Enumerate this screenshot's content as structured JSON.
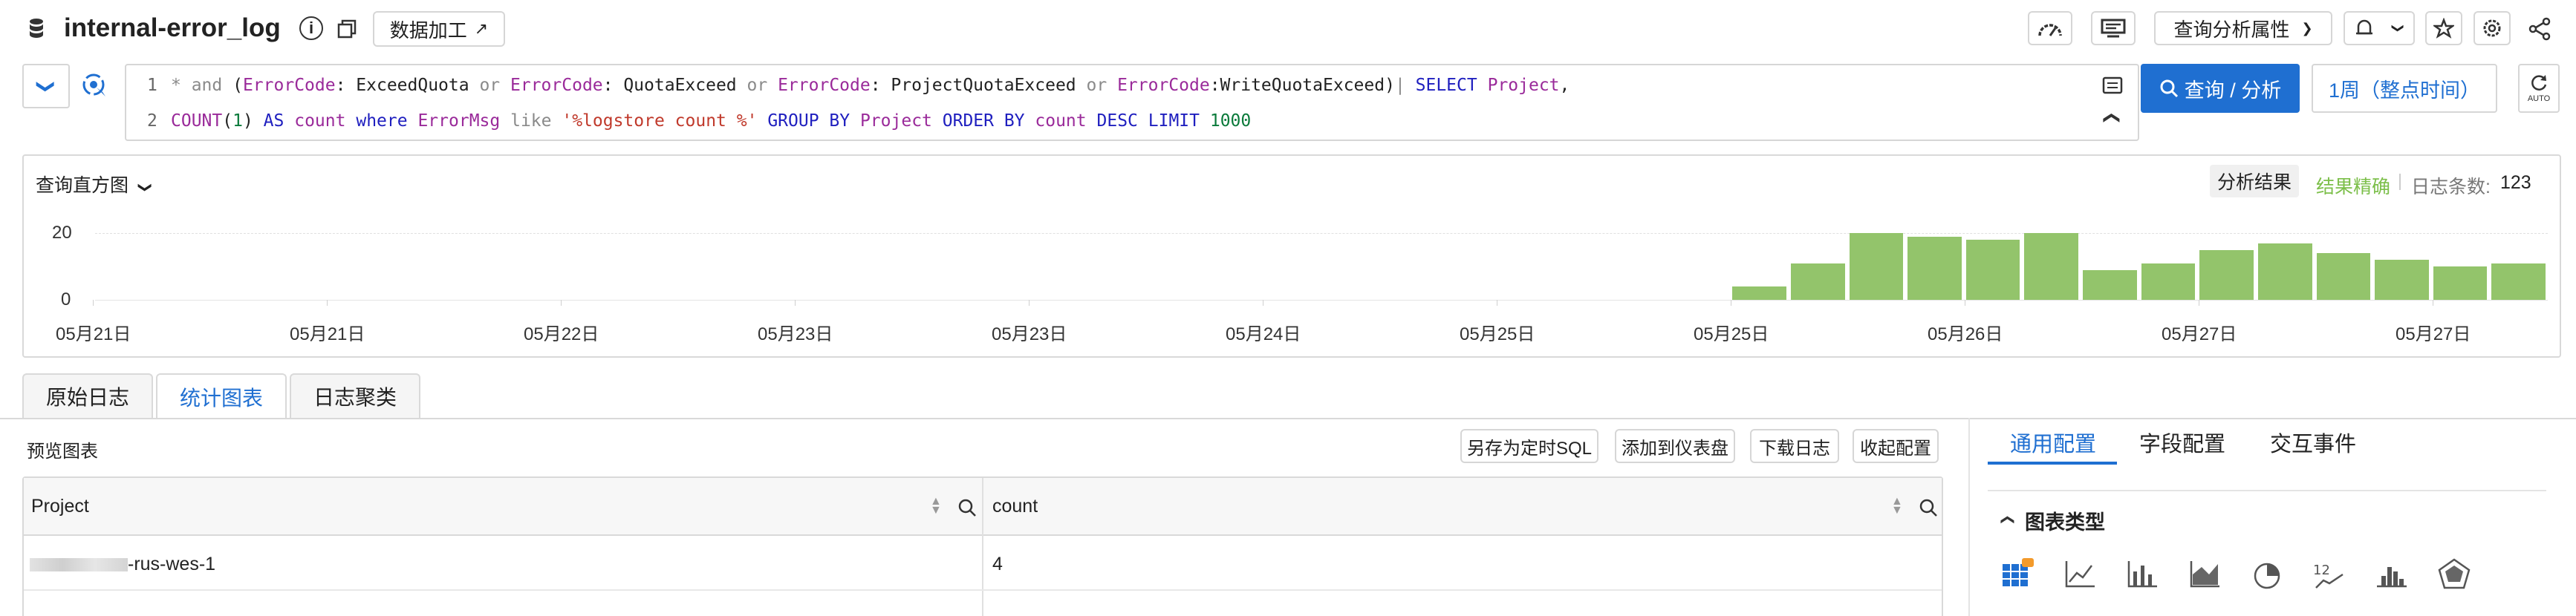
{
  "header": {
    "title": "internal-error_log",
    "data_process_label": "数据加工",
    "query_props_label": "查询分析属性"
  },
  "query": {
    "line_numbers": [
      "1",
      "2"
    ],
    "line1": [
      {
        "t": "* ",
        "c": "op"
      },
      {
        "t": "and",
        "c": "op"
      },
      {
        "t": " (",
        "c": ""
      },
      {
        "t": "ErrorCode",
        "c": "fld"
      },
      {
        "t": ": ExceedQuota ",
        "c": ""
      },
      {
        "t": "or",
        "c": "op"
      },
      {
        "t": " ",
        "c": ""
      },
      {
        "t": "ErrorCode",
        "c": "fld"
      },
      {
        "t": ": QuotaExceed ",
        "c": ""
      },
      {
        "t": "or",
        "c": "op"
      },
      {
        "t": " ",
        "c": ""
      },
      {
        "t": "ErrorCode",
        "c": "fld"
      },
      {
        "t": ": ProjectQuotaExceed ",
        "c": ""
      },
      {
        "t": "or",
        "c": "op"
      },
      {
        "t": " ",
        "c": ""
      },
      {
        "t": "ErrorCode",
        "c": "fld"
      },
      {
        "t": ":WriteQuotaExceed)",
        "c": ""
      },
      {
        "t": "| ",
        "c": "op"
      },
      {
        "t": "SELECT",
        "c": "kw"
      },
      {
        "t": " ",
        "c": ""
      },
      {
        "t": "Project",
        "c": "fld"
      },
      {
        "t": ",",
        "c": ""
      }
    ],
    "line2": [
      {
        "t": "COUNT",
        "c": "fld"
      },
      {
        "t": "(",
        "c": ""
      },
      {
        "t": "1",
        "c": "num"
      },
      {
        "t": ") ",
        "c": ""
      },
      {
        "t": "AS",
        "c": "kw"
      },
      {
        "t": " ",
        "c": ""
      },
      {
        "t": "count",
        "c": "fld"
      },
      {
        "t": " ",
        "c": ""
      },
      {
        "t": "where",
        "c": "kw"
      },
      {
        "t": " ",
        "c": ""
      },
      {
        "t": "ErrorMsg",
        "c": "fld"
      },
      {
        "t": " ",
        "c": ""
      },
      {
        "t": "like",
        "c": "op"
      },
      {
        "t": " ",
        "c": ""
      },
      {
        "t": "'%logstore count %'",
        "c": "str"
      },
      {
        "t": " ",
        "c": ""
      },
      {
        "t": "GROUP BY",
        "c": "kw"
      },
      {
        "t": " ",
        "c": ""
      },
      {
        "t": "Project",
        "c": "fld"
      },
      {
        "t": " ",
        "c": ""
      },
      {
        "t": "ORDER BY",
        "c": "kw"
      },
      {
        "t": " ",
        "c": ""
      },
      {
        "t": "count",
        "c": "fld"
      },
      {
        "t": " ",
        "c": ""
      },
      {
        "t": "DESC",
        "c": "kw"
      },
      {
        "t": " ",
        "c": ""
      },
      {
        "t": "LIMIT",
        "c": "kw"
      },
      {
        "t": " ",
        "c": ""
      },
      {
        "t": "1000",
        "c": "num"
      }
    ],
    "search_button": "查询 / 分析",
    "time_range": "1周（整点时间）",
    "auto_label": "AUTO"
  },
  "histogram": {
    "title": "查询直方图",
    "result_label": "分析结果",
    "precision_label": "结果精确",
    "count_label": "日志条数:",
    "count_value": "123",
    "precision_color": "#7cbf4a",
    "bar_color": "#93c46b"
  },
  "chart_data": {
    "type": "bar",
    "y_ticks": [
      "20",
      "0"
    ],
    "ylim": [
      0,
      25
    ],
    "x_ticks": [
      "05月21日",
      "05月21日",
      "05月22日",
      "05月23日",
      "05月23日",
      "05月24日",
      "05月25日",
      "05月25日",
      "05月26日",
      "05月27日",
      "05月27日"
    ],
    "values": [
      0,
      0,
      0,
      0,
      0,
      0,
      0,
      0,
      0,
      0,
      0,
      0,
      0,
      0,
      0,
      0,
      0,
      0,
      0,
      0,
      0,
      0,
      0,
      0,
      0,
      0,
      0,
      0,
      4,
      11,
      20,
      19,
      18,
      20,
      9,
      11,
      15,
      17,
      14,
      12,
      10,
      11
    ]
  },
  "tabs": [
    "原始日志",
    "统计图表",
    "日志聚类"
  ],
  "preview": {
    "title": "预览图表",
    "actions": [
      "另存为定时SQL",
      "添加到仪表盘",
      "下载日志",
      "收起配置"
    ],
    "columns": [
      "Project",
      "count"
    ],
    "rows": [
      [
        "-rus-wes-1",
        "4"
      ]
    ]
  },
  "config": {
    "tabs": [
      "通用配置",
      "字段配置",
      "交互事件"
    ],
    "section_title": "图表类型",
    "chart_types": [
      "table-chart-icon",
      "line-chart-icon",
      "bar-chart-icon",
      "area-chart-icon",
      "pie-chart-icon",
      "number-chart-icon",
      "histogram-icon",
      "radar-chart-icon"
    ]
  }
}
